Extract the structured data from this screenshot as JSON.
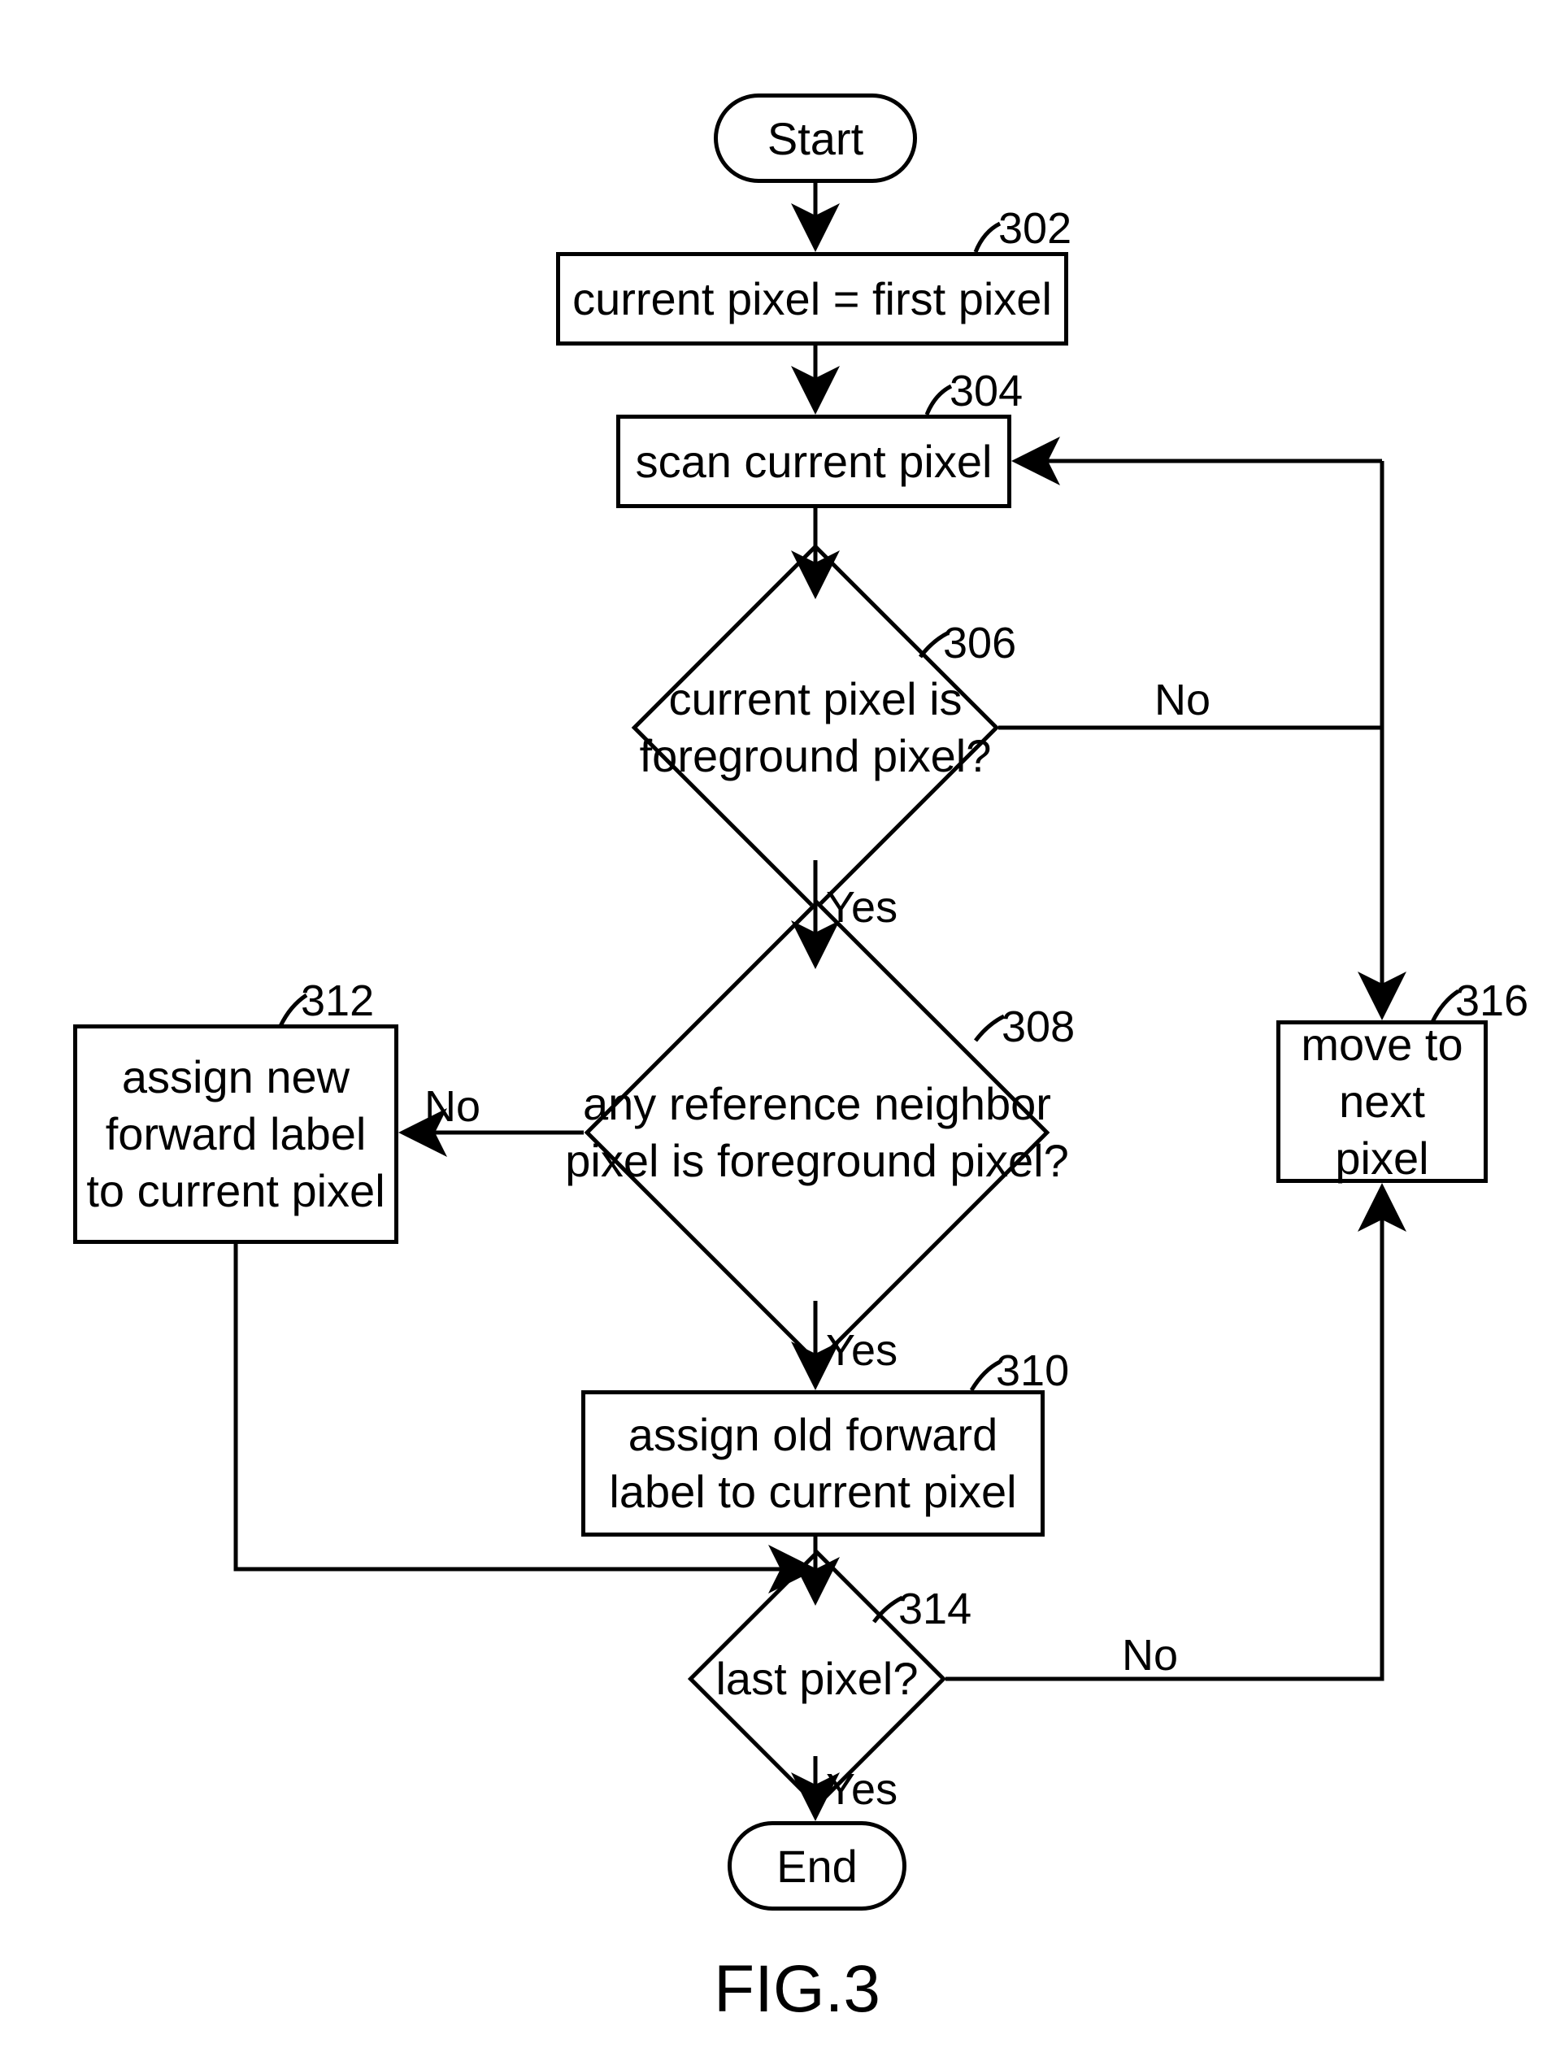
{
  "figure_caption": "FIG.3",
  "nodes": {
    "start": {
      "label": "Start",
      "ref": ""
    },
    "n302": {
      "label": "current pixel = first pixel",
      "ref": "302"
    },
    "n304": {
      "label": "scan current pixel",
      "ref": "304"
    },
    "n306": {
      "label": "current pixel is foreground pixel?",
      "ref": "306"
    },
    "n308": {
      "label": "any reference neighbor pixel is foreground pixel?",
      "ref": "308"
    },
    "n310": {
      "label": "assign old forward label to current pixel",
      "ref": "310"
    },
    "n312": {
      "label": "assign new forward label to current pixel",
      "ref": "312"
    },
    "n314": {
      "label": "last pixel?",
      "ref": "314"
    },
    "n316": {
      "label": "move to next pixel",
      "ref": "316"
    },
    "end": {
      "label": "End",
      "ref": ""
    }
  },
  "edges": {
    "e_start_302": {
      "label": ""
    },
    "e_302_304": {
      "label": ""
    },
    "e_304_306": {
      "label": ""
    },
    "e_306_yes": {
      "label": "Yes"
    },
    "e_306_no": {
      "label": "No"
    },
    "e_308_yes": {
      "label": "Yes"
    },
    "e_308_no": {
      "label": "No"
    },
    "e_310_314": {
      "label": ""
    },
    "e_312_314": {
      "label": ""
    },
    "e_314_yes": {
      "label": "Yes"
    },
    "e_314_no": {
      "label": "No"
    },
    "e_316_304": {
      "label": ""
    }
  }
}
